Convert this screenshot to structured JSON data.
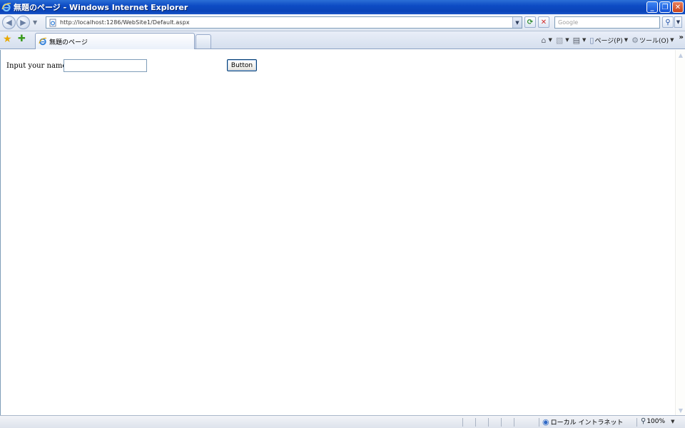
{
  "window": {
    "title": "無題のページ - Windows Internet Explorer",
    "min_glyph": "_",
    "max_glyph": "❐",
    "close_glyph": "✕"
  },
  "address_bar": {
    "url": "http://localhost:1286/WebSite1/Default.aspx",
    "search_placeholder": "Google"
  },
  "tabs": [
    {
      "label": "無題のページ",
      "active": true
    }
  ],
  "command_bar": {
    "page_label": "ページ(P)",
    "tools_label": "ツール(O)"
  },
  "form": {
    "label": "Input your name",
    "input_value": "",
    "button_label": "Button"
  },
  "status_bar": {
    "zone": "ローカル イントラネット",
    "zoom": "100%"
  },
  "colors": {
    "titlebar": "#0a44b8",
    "accent": "#7f9db9"
  },
  "icons": {
    "browser": "ie-icon",
    "back": "back-arrow-icon",
    "forward": "forward-arrow-icon",
    "refresh": "refresh-icon",
    "stop": "stop-icon",
    "search": "search-icon",
    "favorites": "star-icon",
    "add_favorites": "add-favorites-icon",
    "home": "home-icon",
    "feeds": "feed-icon",
    "print": "print-icon",
    "page": "page-icon",
    "tools": "gear-icon",
    "zone": "globe-icon",
    "zoom": "magnifier-icon"
  }
}
